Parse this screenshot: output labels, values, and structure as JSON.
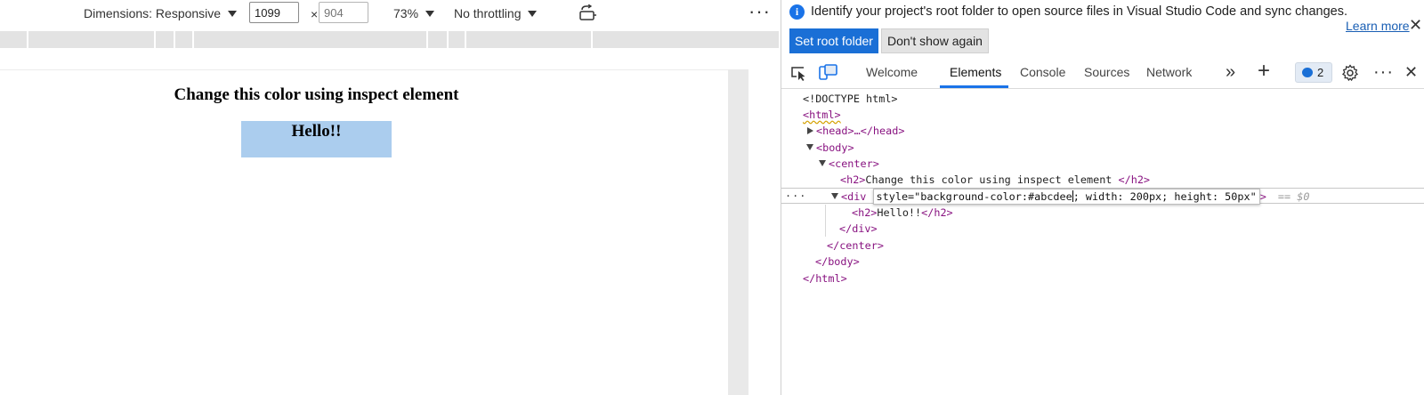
{
  "device_toolbar": {
    "dimensions_label": "Dimensions: Responsive",
    "width_value": "1099",
    "height_placeholder": "904",
    "times_symbol": "×",
    "zoom": "73%",
    "throttling": "No throttling",
    "more": "···"
  },
  "page": {
    "heading": "Change this color using inspect element",
    "box_text": "Hello!!",
    "box_color": "#abcdee"
  },
  "infobar": {
    "message": "Identify your project's root folder to open source files in Visual Studio Code and sync changes.",
    "learn_more": "Learn more",
    "set_root_button": "Set root folder",
    "dont_show_button": "Don't show again",
    "close": "✕"
  },
  "tabs": {
    "welcome": "Welcome",
    "elements": "Elements",
    "console": "Console",
    "sources": "Sources",
    "network": "Network",
    "overflow": "»",
    "add": "+",
    "issues_count": "2",
    "more": "···",
    "close": "✕"
  },
  "dom": {
    "doctype": "<!DOCTYPE html>",
    "html_open": "<html>",
    "head": "<head>…</head>",
    "body_open": "<body>",
    "center_open": "<center>",
    "h2_open": "<h2>",
    "h2_text": "Change this color using inspect element ",
    "h2_close": "</h2>",
    "div_open": "<div",
    "attr_before_caret": "style=\"background-color:#abcdee",
    "attr_after_caret": "; width: 200px; height: 50px\"",
    "div_gt": ">",
    "dollar0": "== $0",
    "hello_open": "<h2>",
    "hello_text": "Hello!!",
    "hello_close": "</h2>",
    "div_close": "</div>",
    "center_close": "</center>",
    "body_close": "</body>",
    "html_close": "</html>",
    "row_dots": "···"
  },
  "colors": {
    "accent": "#1a73e8",
    "tag": "#881280",
    "box": "#abcdee"
  }
}
